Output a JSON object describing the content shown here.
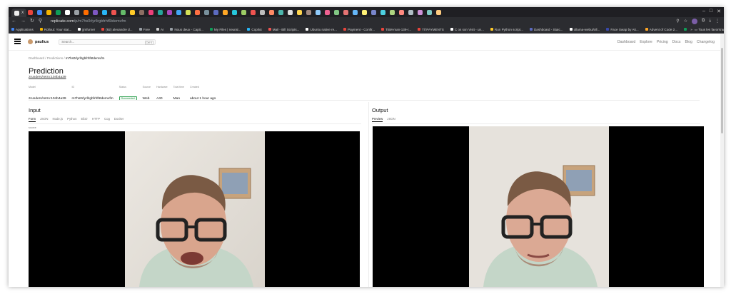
{
  "browser": {
    "active_tab_title": "X",
    "url_host": "replicate.com",
    "url_path": "/p/m7hs0rlyrllrgbfrhf6tdemvfm",
    "bookmarks": [
      "Applications",
      "Rollout: Your stat...",
      "jjmfurner",
      "(92) alexandre d...",
      "Free",
      "AI",
      "Nous deux - Capit...",
      "My Files | neural...",
      "Copilot",
      "Mail - Bill Scripts...",
      "Ubuntu native re...",
      "Payment - Confir...",
      "TBM-man-139-r...",
      "Tif PAYMENTS",
      "C os son Visit - un...",
      "Run Python script...",
      "Dashboard - Staic...",
      "ollama-webui/oll...",
      "Face Swap by Ak...",
      "Advent of Code 2...",
      "FNO+ Alarm",
      "Mirari - Artthenke",
      "Facehapper | F..."
    ],
    "bookmarks_overflow": "»",
    "all_bookmarks": "Tous les favoris",
    "tab_icon_colors": [
      "#e8453c",
      "#4285f4",
      "#f4b400",
      "#0f9d58",
      "#ffffff",
      "#9aa0a6",
      "#ff6d00",
      "#7e57c2",
      "#29b6f6",
      "#ef5350",
      "#66bb6a",
      "#ffca28",
      "#8d6e63",
      "#ec407a",
      "#26a69a",
      "#ab47bc",
      "#42a5f5",
      "#d4e157",
      "#ff7043",
      "#78909c",
      "#5c6bc0",
      "#ffa726",
      "#26c6da",
      "#9ccc65",
      "#ef5350",
      "#bdbdbd",
      "#ff8a65",
      "#4db6ac",
      "#e0e0e0",
      "#ffd54f",
      "#a1887f",
      "#90caf9",
      "#f06292",
      "#81c784",
      "#e57373",
      "#64b5f6",
      "#fff176",
      "#7986cb",
      "#4dd0e1",
      "#aed581",
      "#ff8a80",
      "#b0bec5",
      "#ce93d8",
      "#80cbc4",
      "#ffcc80"
    ]
  },
  "app": {
    "username": "paulius",
    "search_placeholder": "Search...",
    "search_shortcut": "Ctrl K",
    "nav_links": [
      "Dashboard",
      "Explore",
      "Pricing",
      "Docs",
      "Blog",
      "Changelog"
    ]
  },
  "breadcrumb": {
    "dashboard": "Dashboard",
    "predictions": "Predictions",
    "current": "m7hs0rlyrllrgbfrhf6tdemvfm",
    "separator": "/"
  },
  "prediction": {
    "title": "Prediction",
    "model_ref": "zrunders/retro:104b4a39",
    "meta": [
      {
        "label": "Model",
        "value": "zrunders/retro:104b4a39",
        "link": true
      },
      {
        "label": "ID",
        "value": "m7hs0rlyrllrgbfrhf6tdemvfm",
        "link": false
      },
      {
        "label": "Status",
        "value": "Succeeded",
        "badge": true
      },
      {
        "label": "Source",
        "value": "Web",
        "link": false
      },
      {
        "label": "Hardware",
        "value": "A40",
        "link": false
      },
      {
        "label": "Total time",
        "value": "Man",
        "link": false
      },
      {
        "label": "Created",
        "value": "about 1 hour ago",
        "link": false
      }
    ]
  },
  "input_panel": {
    "heading": "Input",
    "tabs": [
      "Form",
      "JSON",
      "Node.js",
      "Python",
      "Elixir",
      "HTTP",
      "Cog",
      "Docker"
    ],
    "active_tab": "Form",
    "field_label": "source"
  },
  "output_panel": {
    "heading": "Output",
    "tabs": [
      "Preview",
      "JSON"
    ],
    "active_tab": "Preview"
  },
  "colors": {
    "status_green": "#2f8f4a",
    "chrome_dark": "#1f1f23",
    "video_bg": "#000000"
  }
}
